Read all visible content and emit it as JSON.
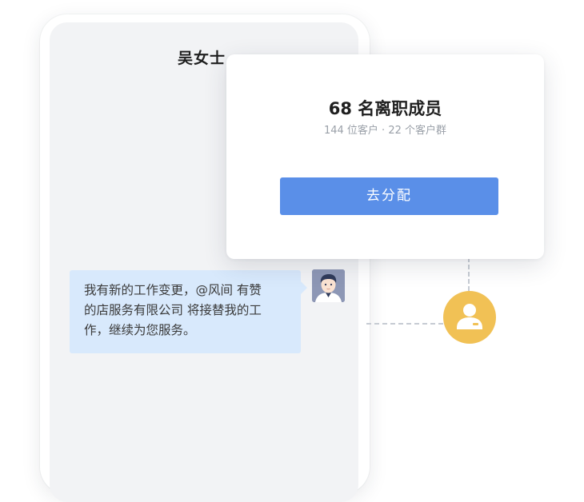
{
  "chat": {
    "contact_name": "吴女士",
    "message_lines": [
      "我有新的工作变更，@风间 有赞",
      "的店服务有限公司 将接替我的工",
      "作，继续为您服务。"
    ],
    "sender_avatar": "male-user-avatar",
    "bubble_color": "#d8e9fc"
  },
  "card": {
    "title": "68 名离职成员",
    "subtitle": "144 位客户 · 22 个客户群",
    "button_label": "去分配",
    "button_color": "#5a8fe8"
  },
  "staff_node": {
    "icon": "staff-user-icon",
    "color": "#f1c155"
  }
}
